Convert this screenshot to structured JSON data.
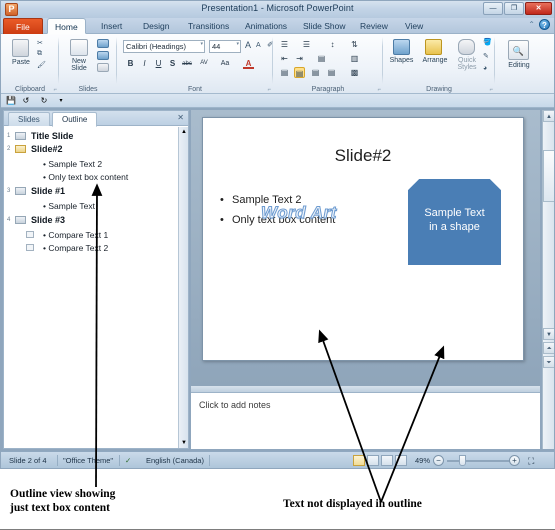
{
  "window": {
    "title": "Presentation1  -  Microsoft PowerPoint",
    "logo_letter": "P",
    "minimize": "—",
    "restore": "❐",
    "close": "✕"
  },
  "ribbon": {
    "tabs": [
      {
        "label": "File",
        "type": "file"
      },
      {
        "label": "Home",
        "type": "active"
      },
      {
        "label": "Insert",
        "type": "normal"
      },
      {
        "label": "Design",
        "type": "normal"
      },
      {
        "label": "Transitions",
        "type": "normal"
      },
      {
        "label": "Animations",
        "type": "normal"
      },
      {
        "label": "Slide Show",
        "type": "normal"
      },
      {
        "label": "Review",
        "type": "normal"
      },
      {
        "label": "View",
        "type": "normal"
      }
    ],
    "help_minimize": "⌃",
    "help_question": "?",
    "groups": {
      "clipboard": {
        "label": "Clipboard",
        "paste": "Paste",
        "cut": "✂",
        "copy": "⧉",
        "format_painter": "🖌",
        "dialog": "⌐"
      },
      "slides": {
        "label": "Slides",
        "new_slide": "New\nSlide",
        "new_slide_line1": "New",
        "new_slide_line2": "Slide",
        "layout": "▤",
        "reset": "↺",
        "section": "▦"
      },
      "font": {
        "label": "Font",
        "font_name": "Calibri (Headings)",
        "font_size": "44",
        "grow": "A",
        "shrink": "A",
        "clear_formatting": "✐",
        "bold": "B",
        "italic": "I",
        "underline": "U",
        "shadow": "S",
        "strikethrough": "abc",
        "spacing": "AV",
        "change_case": "Aa",
        "font_color": "A",
        "dialog": "⌐"
      },
      "paragraph": {
        "label": "Paragraph",
        "bullets": "☰",
        "numbering": "☰",
        "decrease_indent": "⇤",
        "increase_indent": "⇥",
        "line_spacing": "↕",
        "text_direction": "⇅",
        "align_text": "▤",
        "convert_smartart": "▩",
        "align_left": "▤",
        "align_center": "▤",
        "align_right": "▤",
        "justify": "▤",
        "columns": "▥",
        "dialog": "⌐"
      },
      "drawing": {
        "label": "Drawing",
        "shapes": "Shapes",
        "arrange": "Arrange",
        "quick_styles_line1": "Quick",
        "quick_styles_line2": "Styles",
        "shape_fill": "🪣",
        "shape_outline": "✎",
        "shape_effects": "◕",
        "dialog": "⌐"
      },
      "editing": {
        "label": "",
        "editing": "Editing",
        "icon": "🔍"
      }
    }
  },
  "quick_access": {
    "save": "💾",
    "undo": "↺",
    "redo": "↻",
    "customize": "▾"
  },
  "outline_pane": {
    "tabs": [
      {
        "label": "Slides",
        "active": false
      },
      {
        "label": "Outline",
        "active": true
      }
    ],
    "close": "✕",
    "scroll_up": "▲",
    "scroll_down": "▼",
    "items": [
      {
        "number": "1",
        "title": "Title  Slide",
        "selected": false,
        "bullets": []
      },
      {
        "number": "2",
        "title": "Slide#2",
        "selected": true,
        "bullets": [
          "Sample Text 2",
          "Only  text box content"
        ]
      },
      {
        "number": "3",
        "title": "Slide  #1",
        "selected": false,
        "bullets": [
          "Sample Text"
        ]
      },
      {
        "number": "4",
        "title": "Slide  #3",
        "selected": false,
        "bullets": [
          "Compare Text 1",
          "Compare Text 2"
        ]
      }
    ]
  },
  "slide": {
    "title": "Slide#2",
    "bullets": [
      "Sample Text 2",
      "Only text box content"
    ],
    "word_art": "Word Art",
    "shape_text_line1": "Sample Text",
    "shape_text_line2": "in a shape",
    "shape_color": "#4a7eb5",
    "wordart_color": "#eef4fb",
    "wordart_outline": "#6d9bd0"
  },
  "notes": {
    "placeholder": "Click to add notes"
  },
  "scrollbar": {
    "up": "▲",
    "down": "▼",
    "prev_slide": "⏶",
    "next_slide": "⏷"
  },
  "status_bar": {
    "slide_counter": "Slide 2 of 4",
    "theme": "\"Office Theme\"",
    "spellcheck_icon": "✓",
    "language": "English (Canada)",
    "zoom": "49%",
    "zoom_out": "−",
    "zoom_in": "+",
    "fit_window": "⛶",
    "views": [
      {
        "name": "normal",
        "glyph": "▣",
        "active": true
      },
      {
        "name": "slide-sorter",
        "glyph": "▦",
        "active": false
      },
      {
        "name": "reading",
        "glyph": "▥",
        "active": false
      },
      {
        "name": "slide-show",
        "glyph": "▱",
        "active": false
      }
    ]
  },
  "annotations": {
    "left_caption_line1": "Outline view showing",
    "left_caption_line2": "just text box content",
    "right_caption": "Text not displayed in outline"
  }
}
